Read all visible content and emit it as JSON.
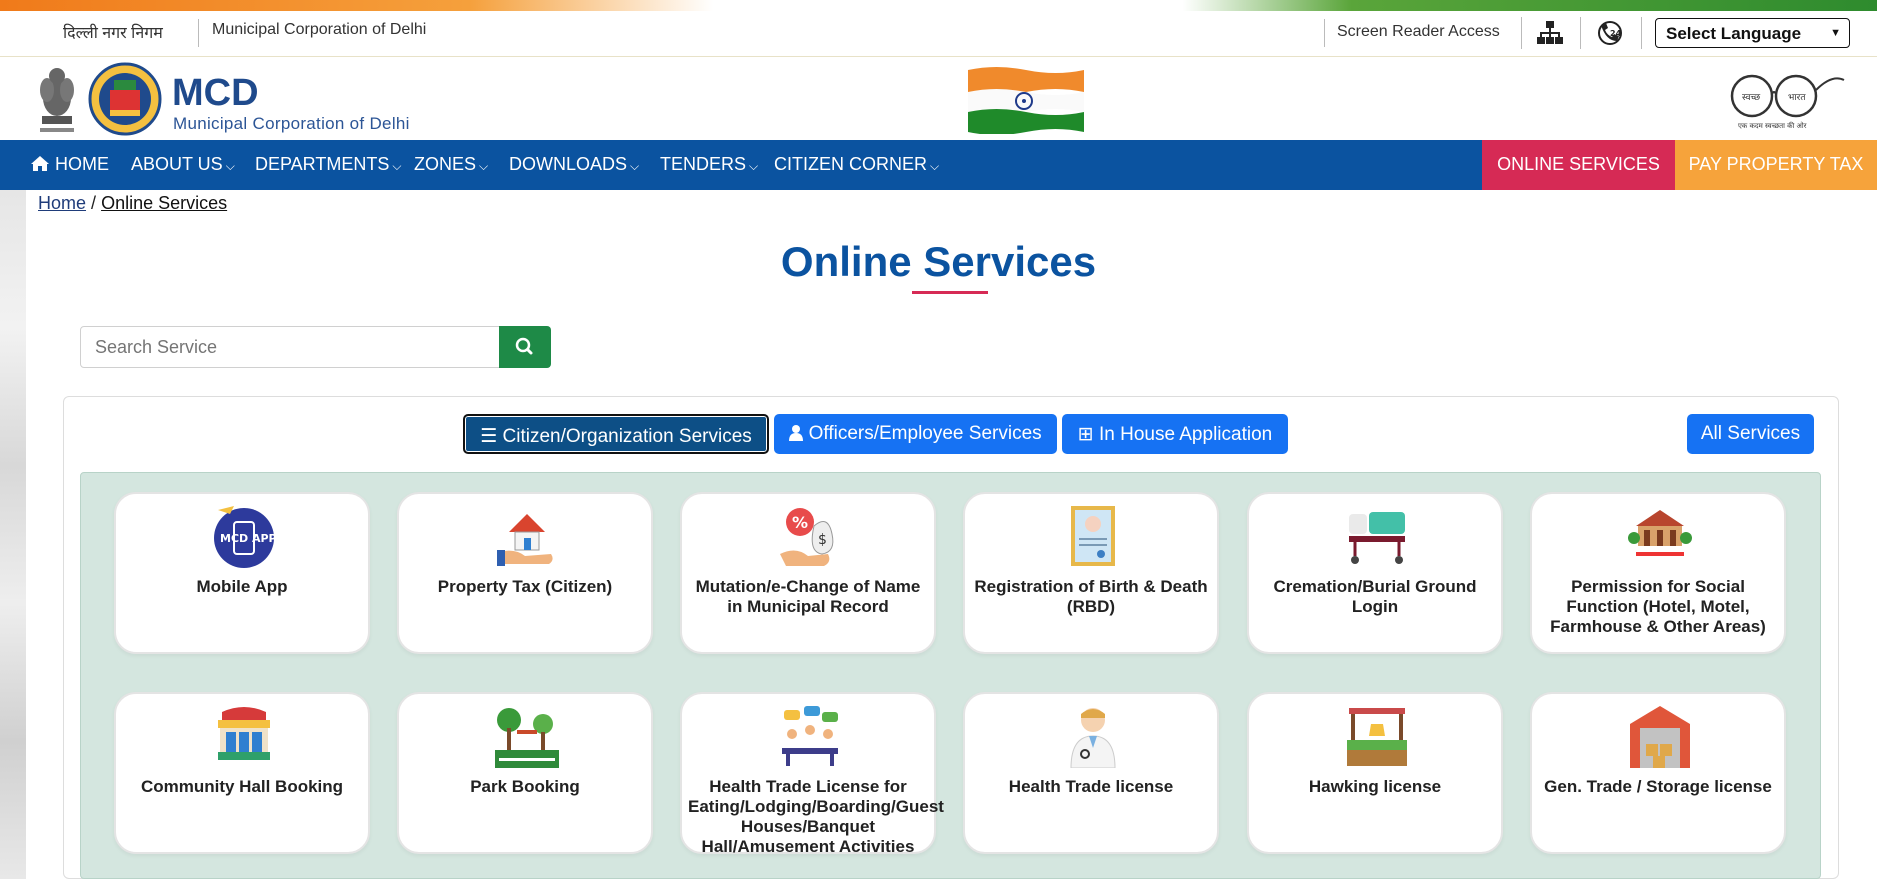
{
  "topbar": {
    "hindi_name": "दिल्ली नगर निगम",
    "english_name": "Municipal Corporation of Delhi",
    "screen_reader": "Screen Reader Access",
    "language_select": "Select Language"
  },
  "header": {
    "logo_title": "MCD",
    "logo_subtitle": "Municipal Corporation of Delhi"
  },
  "nav": {
    "items": [
      {
        "label": "HOME"
      },
      {
        "label": "ABOUT US"
      },
      {
        "label": "DEPARTMENTS"
      },
      {
        "label": "ZONES"
      },
      {
        "label": "DOWNLOADS"
      },
      {
        "label": "TENDERS"
      },
      {
        "label": "CITIZEN CORNER"
      }
    ],
    "online_services": "ONLINE SERVICES",
    "pay_property_tax": "PAY PROPERTY TAX"
  },
  "breadcrumb": {
    "home": "Home",
    "separator": "/",
    "current": "Online Services"
  },
  "page": {
    "title": "Online Services",
    "search_placeholder": "Search Service"
  },
  "tabs": {
    "citizen": "Citizen/Organization Services",
    "officer": "Officers/Employee Services",
    "inhouse": "In House Application",
    "all": "All Services"
  },
  "services": [
    {
      "label": "Mobile App",
      "icon": "mobile-app-icon"
    },
    {
      "label": "Property Tax (Citizen)",
      "icon": "house-in-hand-icon"
    },
    {
      "label": "Mutation/e-Change of Name in Municipal Record",
      "icon": "money-hand-icon"
    },
    {
      "label": "Registration of Birth & Death (RBD)",
      "icon": "certificate-icon"
    },
    {
      "label": "Cremation/Burial Ground Login",
      "icon": "stretcher-icon"
    },
    {
      "label": "Permission for Social Function (Hotel, Motel, Farmhouse & Other Areas)",
      "icon": "social-function-icon"
    },
    {
      "label": "Community Hall Booking",
      "icon": "community-hall-icon"
    },
    {
      "label": "Park Booking",
      "icon": "park-icon"
    },
    {
      "label": "Health Trade License for Eating/Lodging/Boarding/Guest Houses/Banquet Hall/Amusement Activities",
      "icon": "meeting-icon"
    },
    {
      "label": "Health Trade license",
      "icon": "doctor-icon"
    },
    {
      "label": "Hawking license",
      "icon": "vendor-stall-icon"
    },
    {
      "label": "Gen. Trade / Storage license",
      "icon": "warehouse-icon"
    }
  ],
  "colors": {
    "nav_blue": "#0b53a0",
    "online_services_red": "#d62a55",
    "pay_tax_orange": "#f6a33b",
    "tab_blue": "#1672f3",
    "search_green": "#1e8a47"
  }
}
